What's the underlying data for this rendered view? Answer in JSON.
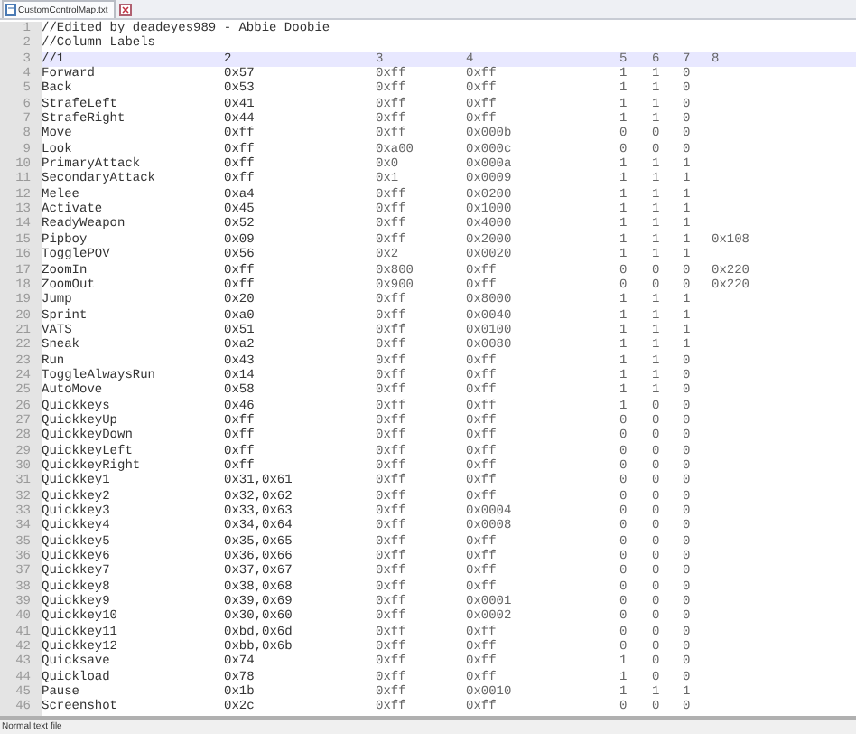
{
  "tab": {
    "title": "CustomControlMap.txt",
    "selected": true
  },
  "lines": [
    {
      "number": "1",
      "current": false,
      "kind": "comment",
      "text": "//Edited by deadeyes989 - Abbie Doobie"
    },
    {
      "number": "2",
      "current": false,
      "kind": "comment",
      "text": "//Column Labels"
    },
    {
      "number": "3",
      "current": true,
      "kind": "row",
      "cells": [
        "//1",
        "2",
        "3",
        "4",
        "5",
        "6",
        "7",
        "8"
      ]
    },
    {
      "number": "4",
      "current": false,
      "kind": "row",
      "cells": [
        "Forward",
        "0x57",
        "0xff",
        "0xff",
        "1",
        "1",
        "0"
      ]
    },
    {
      "number": "5",
      "current": false,
      "kind": "row",
      "cells": [
        "Back",
        "0x53",
        "0xff",
        "0xff",
        "1",
        "1",
        "0"
      ]
    },
    {
      "number": "6",
      "current": false,
      "kind": "row",
      "cells": [
        "StrafeLeft",
        "0x41",
        "0xff",
        "0xff",
        "1",
        "1",
        "0"
      ]
    },
    {
      "number": "7",
      "current": false,
      "kind": "row",
      "cells": [
        "StrafeRight",
        "0x44",
        "0xff",
        "0xff",
        "1",
        "1",
        "0"
      ]
    },
    {
      "number": "8",
      "current": false,
      "kind": "row",
      "cells": [
        "Move",
        "0xff",
        "0xff",
        "0x000b",
        "0",
        "0",
        "0"
      ]
    },
    {
      "number": "9",
      "current": false,
      "kind": "row",
      "cells": [
        "Look",
        "0xff",
        "0xa00",
        "0x000c",
        "0",
        "0",
        "0"
      ]
    },
    {
      "number": "10",
      "current": false,
      "kind": "row",
      "cells": [
        "PrimaryAttack",
        "0xff",
        "0x0",
        "0x000a",
        "1",
        "1",
        "1"
      ]
    },
    {
      "number": "11",
      "current": false,
      "kind": "row",
      "cells": [
        "SecondaryAttack",
        "0xff",
        "0x1",
        "0x0009",
        "1",
        "1",
        "1"
      ]
    },
    {
      "number": "12",
      "current": false,
      "kind": "row",
      "cells": [
        "Melee",
        "0xa4",
        "0xff",
        "0x0200",
        "1",
        "1",
        "1"
      ]
    },
    {
      "number": "13",
      "current": false,
      "kind": "row",
      "cells": [
        "Activate",
        "0x45",
        "0xff",
        "0x1000",
        "1",
        "1",
        "1"
      ]
    },
    {
      "number": "14",
      "current": false,
      "kind": "row",
      "cells": [
        "ReadyWeapon",
        "0x52",
        "0xff",
        "0x4000",
        "1",
        "1",
        "1"
      ]
    },
    {
      "number": "15",
      "current": false,
      "kind": "row",
      "cells": [
        "Pipboy",
        "0x09",
        "0xff",
        "0x2000",
        "1",
        "1",
        "1",
        "0x108"
      ]
    },
    {
      "number": "16",
      "current": false,
      "kind": "row",
      "cells": [
        "TogglePOV",
        "0x56",
        "0x2",
        "0x0020",
        "1",
        "1",
        "1"
      ]
    },
    {
      "number": "17",
      "current": false,
      "kind": "row",
      "cells": [
        "ZoomIn",
        "0xff",
        "0x800",
        "0xff",
        "0",
        "0",
        "0",
        "0x220"
      ]
    },
    {
      "number": "18",
      "current": false,
      "kind": "row",
      "cells": [
        "ZoomOut",
        "0xff",
        "0x900",
        "0xff",
        "0",
        "0",
        "0",
        "0x220"
      ]
    },
    {
      "number": "19",
      "current": false,
      "kind": "row",
      "cells": [
        "Jump",
        "0x20",
        "0xff",
        "0x8000",
        "1",
        "1",
        "1"
      ]
    },
    {
      "number": "20",
      "current": false,
      "kind": "row",
      "cells": [
        "Sprint",
        "0xa0",
        "0xff",
        "0x0040",
        "1",
        "1",
        "1"
      ]
    },
    {
      "number": "21",
      "current": false,
      "kind": "row",
      "cells": [
        "VATS",
        "0x51",
        "0xff",
        "0x0100",
        "1",
        "1",
        "1"
      ]
    },
    {
      "number": "22",
      "current": false,
      "kind": "row",
      "cells": [
        "Sneak",
        "0xa2",
        "0xff",
        "0x0080",
        "1",
        "1",
        "1"
      ]
    },
    {
      "number": "23",
      "current": false,
      "kind": "row",
      "cells": [
        "Run",
        "0x43",
        "0xff",
        "0xff",
        "1",
        "1",
        "0"
      ]
    },
    {
      "number": "24",
      "current": false,
      "kind": "row",
      "cells": [
        "ToggleAlwaysRun",
        "0x14",
        "0xff",
        "0xff",
        "1",
        "1",
        "0"
      ]
    },
    {
      "number": "25",
      "current": false,
      "kind": "row",
      "cells": [
        "AutoMove",
        "0x58",
        "0xff",
        "0xff",
        "1",
        "1",
        "0"
      ]
    },
    {
      "number": "26",
      "current": false,
      "kind": "row",
      "cells": [
        "Quickkeys",
        "0x46",
        "0xff",
        "0xff",
        "1",
        "0",
        "0"
      ]
    },
    {
      "number": "27",
      "current": false,
      "kind": "row",
      "cells": [
        "QuickkeyUp",
        "0xff",
        "0xff",
        "0xff",
        "0",
        "0",
        "0"
      ]
    },
    {
      "number": "28",
      "current": false,
      "kind": "row",
      "cells": [
        "QuickkeyDown",
        "0xff",
        "0xff",
        "0xff",
        "0",
        "0",
        "0"
      ]
    },
    {
      "number": "29",
      "current": false,
      "kind": "row",
      "cells": [
        "QuickkeyLeft",
        "0xff",
        "0xff",
        "0xff",
        "0",
        "0",
        "0"
      ]
    },
    {
      "number": "30",
      "current": false,
      "kind": "row",
      "cells": [
        "QuickkeyRight",
        "0xff",
        "0xff",
        "0xff",
        "0",
        "0",
        "0"
      ]
    },
    {
      "number": "31",
      "current": false,
      "kind": "row",
      "cells": [
        "Quickkey1",
        "0x31,0x61",
        "0xff",
        "0xff",
        "0",
        "0",
        "0"
      ]
    },
    {
      "number": "32",
      "current": false,
      "kind": "row",
      "cells": [
        "Quickkey2",
        "0x32,0x62",
        "0xff",
        "0xff",
        "0",
        "0",
        "0"
      ]
    },
    {
      "number": "33",
      "current": false,
      "kind": "row",
      "cells": [
        "Quickkey3",
        "0x33,0x63",
        "0xff",
        "0x0004",
        "0",
        "0",
        "0"
      ]
    },
    {
      "number": "34",
      "current": false,
      "kind": "row",
      "cells": [
        "Quickkey4",
        "0x34,0x64",
        "0xff",
        "0x0008",
        "0",
        "0",
        "0"
      ]
    },
    {
      "number": "35",
      "current": false,
      "kind": "row",
      "cells": [
        "Quickkey5",
        "0x35,0x65",
        "0xff",
        "0xff",
        "0",
        "0",
        "0"
      ]
    },
    {
      "number": "36",
      "current": false,
      "kind": "row",
      "cells": [
        "Quickkey6",
        "0x36,0x66",
        "0xff",
        "0xff",
        "0",
        "0",
        "0"
      ]
    },
    {
      "number": "37",
      "current": false,
      "kind": "row",
      "cells": [
        "Quickkey7",
        "0x37,0x67",
        "0xff",
        "0xff",
        "0",
        "0",
        "0"
      ]
    },
    {
      "number": "38",
      "current": false,
      "kind": "row",
      "cells": [
        "Quickkey8",
        "0x38,0x68",
        "0xff",
        "0xff",
        "0",
        "0",
        "0"
      ]
    },
    {
      "number": "39",
      "current": false,
      "kind": "row",
      "cells": [
        "Quickkey9",
        "0x39,0x69",
        "0xff",
        "0x0001",
        "0",
        "0",
        "0"
      ]
    },
    {
      "number": "40",
      "current": false,
      "kind": "row",
      "cells": [
        "Quickkey10",
        "0x30,0x60",
        "0xff",
        "0x0002",
        "0",
        "0",
        "0"
      ]
    },
    {
      "number": "41",
      "current": false,
      "kind": "row",
      "cells": [
        "Quickkey11",
        "0xbd,0x6d",
        "0xff",
        "0xff",
        "0",
        "0",
        "0"
      ]
    },
    {
      "number": "42",
      "current": false,
      "kind": "row",
      "cells": [
        "Quickkey12",
        "0xbb,0x6b",
        "0xff",
        "0xff",
        "0",
        "0",
        "0"
      ]
    },
    {
      "number": "43",
      "current": false,
      "kind": "row",
      "cells": [
        "Quicksave",
        "0x74",
        "0xff",
        "0xff",
        "1",
        "0",
        "0"
      ]
    },
    {
      "number": "44",
      "current": false,
      "kind": "row",
      "cells": [
        "Quickload",
        "0x78",
        "0xff",
        "0xff",
        "1",
        "0",
        "0"
      ]
    },
    {
      "number": "45",
      "current": false,
      "kind": "row",
      "cells": [
        "Pause",
        "0x1b",
        "0xff",
        "0x0010",
        "1",
        "1",
        "1"
      ]
    },
    {
      "number": "46",
      "current": false,
      "kind": "row",
      "cells": [
        "Screenshot",
        "0x2c",
        "0xff",
        "0xff",
        "0",
        "0",
        "0"
      ]
    }
  ],
  "status_bar": {
    "file_type": "Normal text file"
  }
}
